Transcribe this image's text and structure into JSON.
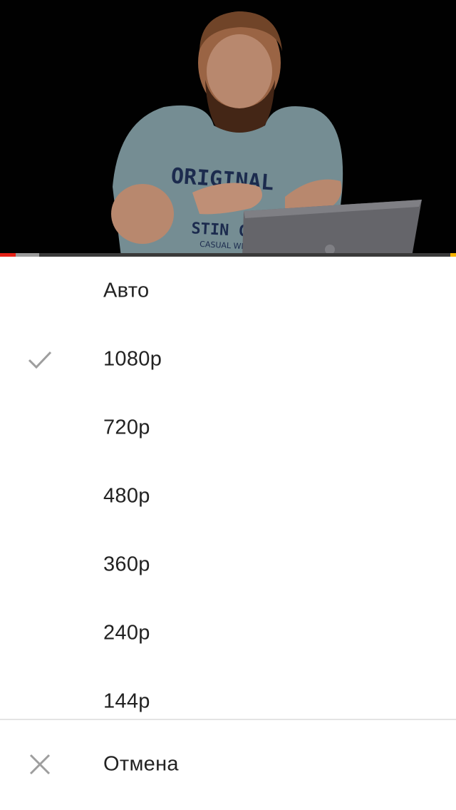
{
  "video": {
    "progress_played_fraction": 0.034,
    "progress_buffered_fraction": 0.086
  },
  "quality_menu": {
    "options": [
      {
        "label": "Авто",
        "selected": false
      },
      {
        "label": "1080p",
        "selected": true
      },
      {
        "label": "720p",
        "selected": false
      },
      {
        "label": "480p",
        "selected": false
      },
      {
        "label": "360p",
        "selected": false
      },
      {
        "label": "240p",
        "selected": false
      },
      {
        "label": "144p",
        "selected": false
      }
    ],
    "selected_icon": "checkmark-icon",
    "cancel": {
      "label": "Отмена",
      "icon": "close-icon"
    }
  },
  "colors": {
    "accent_progress": "#e62117",
    "icon_gray": "#9e9e9e",
    "text": "#222222"
  }
}
